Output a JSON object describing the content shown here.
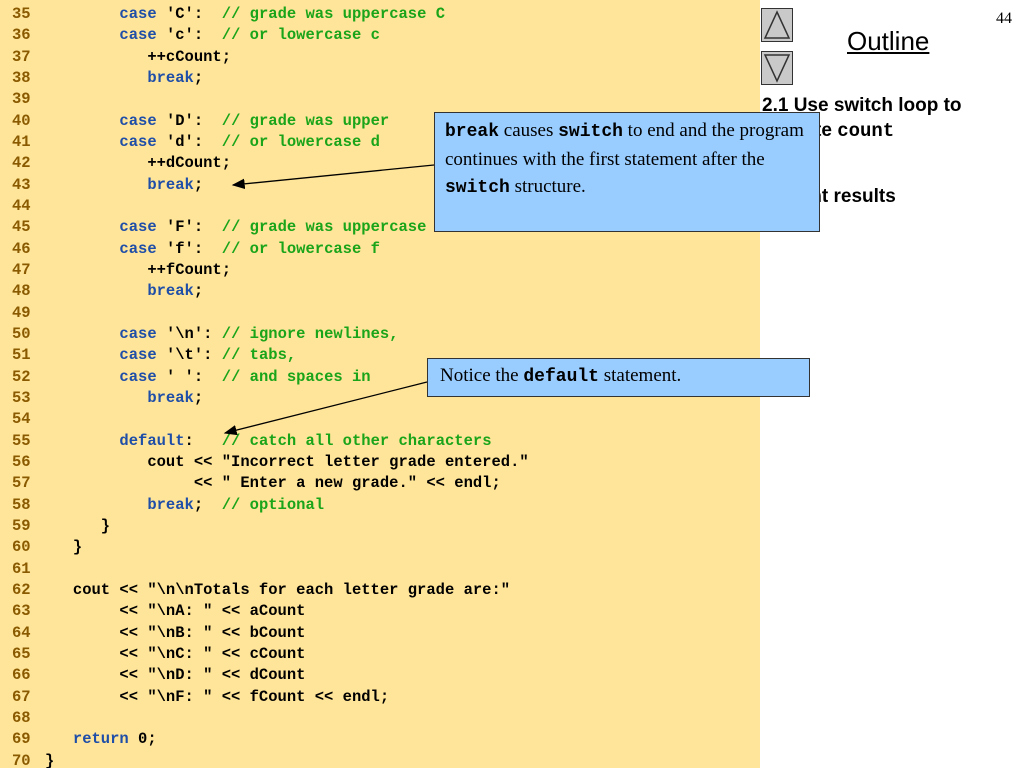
{
  "slide": {
    "number": "44",
    "outline_title": "Outline",
    "outline_items": [
      {
        "prefix": "2.1  Use switch loop to",
        "line2_text": "te ",
        "line2_code": "count"
      },
      {
        "text": "int results"
      }
    ]
  },
  "code_lines": [
    {
      "n": "35",
      "kw": "case",
      "a": " 'C':  ",
      "cm": "// grade was uppercase C",
      "indent": "        "
    },
    {
      "n": "36",
      "kw": "case",
      "a": " 'c':  ",
      "cm": "// or lowercase c",
      "indent": "        "
    },
    {
      "n": "37",
      "text": "           ++cCount;"
    },
    {
      "n": "38",
      "kw": "break",
      "a": ";",
      "indent": "           "
    },
    {
      "n": "39",
      "text": ""
    },
    {
      "n": "40",
      "kw": "case",
      "a": " 'D':  ",
      "cm": "// grade was upper",
      "indent": "        "
    },
    {
      "n": "41",
      "kw": "case",
      "a": " 'd':  ",
      "cm": "// or lowercase d",
      "indent": "        "
    },
    {
      "n": "42",
      "text": "           ++dCount;"
    },
    {
      "n": "43",
      "kw": "break",
      "a": ";",
      "indent": "           "
    },
    {
      "n": "44",
      "text": ""
    },
    {
      "n": "45",
      "kw": "case",
      "a": " 'F':  ",
      "cm": "// grade was uppercase F",
      "indent": "        "
    },
    {
      "n": "46",
      "kw": "case",
      "a": " 'f':  ",
      "cm": "// or lowercase f",
      "indent": "        "
    },
    {
      "n": "47",
      "text": "           ++fCount;"
    },
    {
      "n": "48",
      "kw": "break",
      "a": ";",
      "indent": "           "
    },
    {
      "n": "49",
      "text": ""
    },
    {
      "n": "50",
      "kw": "case",
      "a": " '\\n': ",
      "cm": "// ignore newlines,",
      "indent": "        "
    },
    {
      "n": "51",
      "kw": "case",
      "a": " '\\t': ",
      "cm": "// tabs,",
      "indent": "        "
    },
    {
      "n": "52",
      "kw": "case",
      "a": " ' ':  ",
      "cm": "// and spaces in",
      "indent": "        "
    },
    {
      "n": "53",
      "kw": "break",
      "a": ";",
      "indent": "           "
    },
    {
      "n": "54",
      "text": ""
    },
    {
      "n": "55",
      "kw": "default",
      "a": ":   ",
      "cm": "// catch all other characters",
      "indent": "        "
    },
    {
      "n": "56",
      "text": "           cout << \"Incorrect letter grade entered.\""
    },
    {
      "n": "57",
      "text": "                << \" Enter a new grade.\" << endl;"
    },
    {
      "n": "58",
      "kw": "break",
      "a": ";  ",
      "cm": "// optional",
      "indent": "           "
    },
    {
      "n": "59",
      "text": "      }"
    },
    {
      "n": "60",
      "text": "   }"
    },
    {
      "n": "61",
      "text": ""
    },
    {
      "n": "62",
      "text": "   cout << \"\\n\\nTotals for each letter grade are:\""
    },
    {
      "n": "63",
      "text": "        << \"\\nA: \" << aCount"
    },
    {
      "n": "64",
      "text": "        << \"\\nB: \" << bCount"
    },
    {
      "n": "65",
      "text": "        << \"\\nC: \" << cCount"
    },
    {
      "n": "66",
      "text": "        << \"\\nD: \" << dCount"
    },
    {
      "n": "67",
      "text": "        << \"\\nF: \" << fCount << endl;"
    },
    {
      "n": "68",
      "text": ""
    },
    {
      "n": "69",
      "kw": "return",
      "a": " 0;",
      "indent": "   "
    },
    {
      "n": "70",
      "text": "}"
    }
  ],
  "callouts": {
    "break_box": {
      "kw1": "break",
      "t1": " causes ",
      "kw2": "switch",
      "t2": " to end and the program continues with the first statement after the ",
      "kw3": "switch",
      "t3": " structure."
    },
    "default_box": {
      "t1": "Notice the ",
      "kw": "default",
      "t2": " statement."
    }
  },
  "icons": [
    "nav-up-icon",
    "nav-down-icon"
  ],
  "colors": {
    "code_background": "#ffe599",
    "keyword": "#1f4ea8",
    "comment": "#1aa41a",
    "callout_background": "#99ccff"
  }
}
